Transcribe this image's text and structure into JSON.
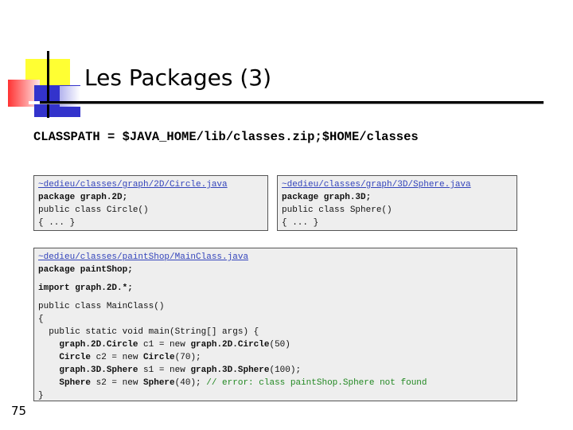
{
  "slide": {
    "title": "Les Packages (3)",
    "classpath": "CLASSPATH = $JAVA_HOME/lib/classes.zip;$HOME/classes",
    "page_number": "75"
  },
  "box_circle": {
    "path": "~dedieu/classes/graph/2D/Circle.java",
    "package_line": "package graph.2D;",
    "class_line": "public class Circle()",
    "body_line": "{ ... }"
  },
  "box_sphere": {
    "path": "~dedieu/classes/graph/3D/Sphere.java",
    "package_line": "package graph.3D;",
    "class_line": "public class Sphere()",
    "body_line": "{ ... }"
  },
  "box_main": {
    "path": "~dedieu/classes/paintShop/MainClass.java",
    "package_line": "package paintShop;",
    "import_line": "import graph.2D.*;",
    "class_line": "public class MainClass()",
    "open_brace": "{",
    "main_sig": "  public static void main(String[] args) {",
    "l1": {
      "a": "graph.2D.Circle",
      "b": " c1 = new ",
      "c": "graph.2D.Circle",
      "d": "(50)"
    },
    "l2": {
      "a": "Circle",
      "b": " c2 = new ",
      "c": "Circle",
      "d": "(70);"
    },
    "l3": {
      "a": "graph.3D.Sphere",
      "b": " s1 = new ",
      "c": "graph.3D.Sphere",
      "d": "(100);"
    },
    "l4": {
      "a": "Sphere",
      "b": " s2 = new ",
      "c": "Sphere",
      "d": "(40); ",
      "comment": "// error: class paintShop.Sphere not found"
    },
    "close_brace": "}"
  },
  "colors": {
    "accent_yellow": "#ffff33",
    "accent_blue": "#3333cc",
    "accent_red": "#ff3333",
    "link": "#3344bb",
    "comment": "#228822",
    "code_bg": "#eeeeee"
  }
}
